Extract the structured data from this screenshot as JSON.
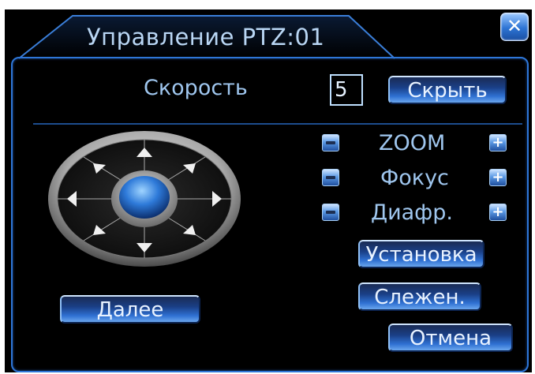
{
  "window": {
    "title": "Управление PTZ:01",
    "close_icon": "close-icon"
  },
  "speed": {
    "label": "Скорость",
    "value": "5",
    "hide_button": "Скрыть"
  },
  "controls": [
    {
      "label": "ZOOM"
    },
    {
      "label": "Фокус"
    },
    {
      "label": "Диафр."
    }
  ],
  "buttons": {
    "setup": "Установка",
    "tracking": "Слежен.",
    "cancel": "Отмена",
    "next": "Далее"
  },
  "joystick": {
    "center_icon": "center-button-icon",
    "directions": [
      "up",
      "down",
      "left",
      "right",
      "up-left",
      "up-right",
      "down-left",
      "down-right"
    ]
  },
  "colors": {
    "accent": "#2f70d2",
    "text": "#9fc6ee",
    "background": "#000000"
  }
}
